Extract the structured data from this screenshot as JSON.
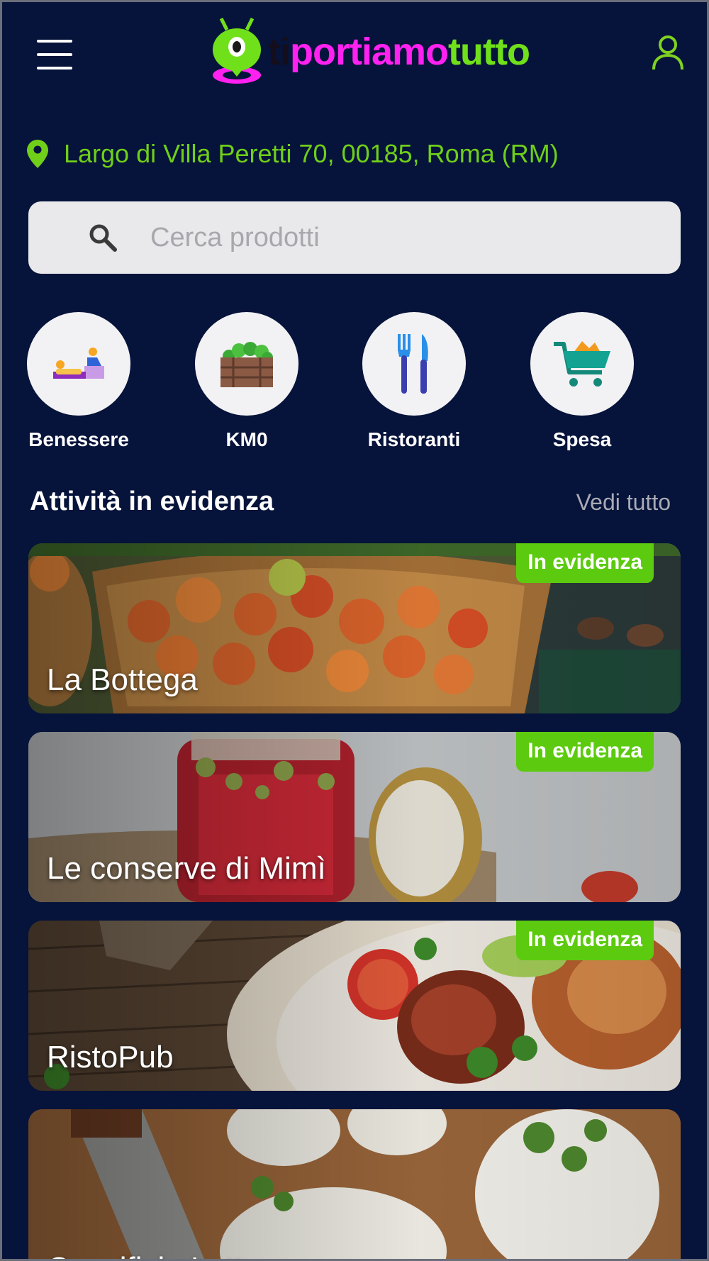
{
  "header": {
    "logo": {
      "part1": "ti",
      "part2": "portiamo",
      "part3": "tutto"
    }
  },
  "location": {
    "address": "Largo di Villa Peretti 70, 00185, Roma (RM)"
  },
  "search": {
    "placeholder": "Cerca prodotti"
  },
  "categories": [
    {
      "label": "Benessere",
      "icon": "massage-icon"
    },
    {
      "label": "KM0",
      "icon": "vegetable-crate-icon"
    },
    {
      "label": "Ristoranti",
      "icon": "fork-knife-icon"
    },
    {
      "label": "Spesa",
      "icon": "shopping-cart-icon"
    }
  ],
  "featured": {
    "title": "Attività in evidenza",
    "see_all": "Vedi tutto",
    "items": [
      {
        "name": "La Bottega",
        "badge": "In evidenza"
      },
      {
        "name": "Le conserve di Mimì",
        "badge": "In evidenza"
      },
      {
        "name": "RistoPub",
        "badge": "In evidenza"
      },
      {
        "name": "Caseificio Latte"
      }
    ]
  },
  "colors": {
    "background": "#06133a",
    "accent_green": "#5ccb0f",
    "address_green": "#6fcf19",
    "logo_magenta": "#ff21f0"
  }
}
